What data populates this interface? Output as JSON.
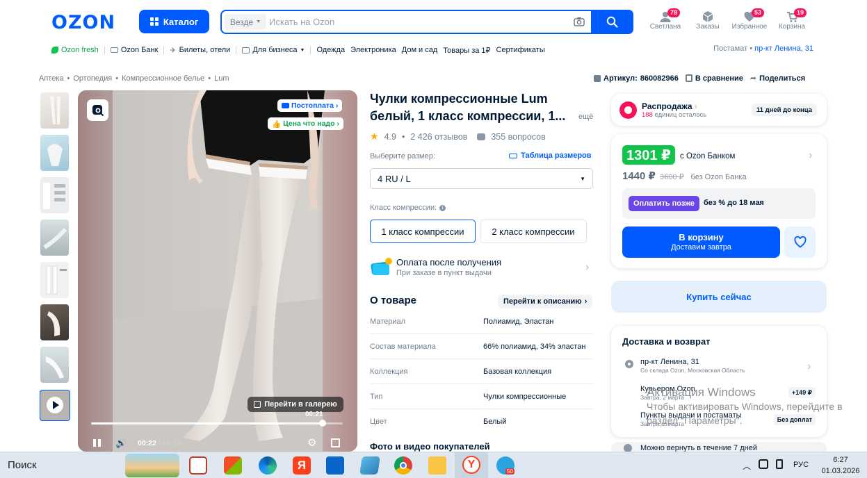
{
  "header": {
    "logo": "OZON",
    "catalog_label": "Каталог",
    "search_scope": "Везде",
    "search_placeholder": "Искать на Ozon",
    "icons": [
      {
        "label": "Светлана",
        "badge": "78",
        "icon": "user-icon"
      },
      {
        "label": "Заказы",
        "badge": "",
        "icon": "box-icon"
      },
      {
        "label": "Избранное",
        "badge": "53",
        "icon": "heart-icon"
      },
      {
        "label": "Корзина",
        "badge": "19",
        "icon": "cart-icon"
      }
    ]
  },
  "nav": {
    "items": [
      "Ozon fresh",
      "Ozon Банк",
      "Билеты, отели",
      "Для бизнеса",
      "Одежда",
      "Электроника",
      "Дом и сад",
      "Товары за 1₽",
      "Сертификаты"
    ],
    "address_label": "Постамат •",
    "address_value": "пр-кт Ленина, 31"
  },
  "breadcrumbs": [
    "Аптека",
    "Ортопедия",
    "Компрессионное белье",
    "Lum"
  ],
  "meta": {
    "article_label": "Артикул:",
    "article_value": "860082966",
    "compare": "В сравнение",
    "share": "Поделиться"
  },
  "media": {
    "postpay_badge": "Постоплата",
    "price_badge": "Цена что надо",
    "gallery_button": "Перейти в галерею",
    "time_hover": "00:21",
    "time_current": "00:22",
    "time_total": "00:24",
    "progress": 0.92
  },
  "product": {
    "title_line1": "Чулки компрессионные Lum",
    "title_line2": "белый, 1 класс компрессии, 1...",
    "more": "ещё",
    "rating": "4.9",
    "reviews": "2 426 отзывов",
    "questions": "355 вопросов",
    "size_label": "Выберите размер:",
    "size_table": "Таблица размеров",
    "size_value": "4 RU / L",
    "class_label": "Класс компрессии:",
    "class_options": [
      "1 класс компрессии",
      "2 класс компрессии"
    ],
    "payment_title": "Оплата после получения",
    "payment_sub": "При заказе в пункт выдачи",
    "about_title": "О товаре",
    "about_link": "Перейти к описанию",
    "specs": [
      {
        "k": "Материал",
        "v": "Полиамид, Эластан"
      },
      {
        "k": "Состав материала",
        "v": "66% полиамид, 34% эластан"
      },
      {
        "k": "Коллекция",
        "v": "Базовая коллекция"
      },
      {
        "k": "Тип",
        "v": "Чулки компрессионные"
      },
      {
        "k": "Цвет",
        "v": "Белый"
      }
    ],
    "photos_title": "Фото и видео покупателей"
  },
  "sale": {
    "title": "Распродажа",
    "sub_count": "188",
    "sub_text": "единиц осталось",
    "days": "11 дней до конца"
  },
  "price": {
    "bank_price": "1301 ₽",
    "bank_label": "с Ozon Банком",
    "regular": "1440 ₽",
    "old": "3600 ₽",
    "regular_label": "без Ozon Банка",
    "later_btn": "Оплатить позже",
    "later_text": "без % до 18 мая",
    "cart_btn": "В корзину",
    "cart_sub": "Доставим завтра",
    "buy_now": "Купить сейчас"
  },
  "delivery": {
    "title": "Доставка и возврат",
    "address": "пр-кт Ленина, 31",
    "address_sub": "Со склада Ozon, Московская Область",
    "courier": "Курьером Ozon",
    "courier_date": "Завтра, 2 марта",
    "courier_price": "+149 ₽",
    "pickup": "Пункты выдачи и постаматы",
    "pickup_date": "Завтра, 2 марта",
    "pickup_price": "Без доплат",
    "return": "Можно вернуть в течение 7 дней"
  },
  "watermark": {
    "line1": "Активация Windows",
    "line2": "Чтобы активировать Windows, перейдите в",
    "line3": "раздел \"Параметры\"."
  },
  "taskbar": {
    "search": "Поиск",
    "lang": "РУС",
    "time": "6:27",
    "date": "01.03.2026",
    "telegram_badge": "50"
  },
  "colors": {
    "brand": "#005bff",
    "accent_pink": "#f91155",
    "green": "#10c44c",
    "purple": "#6b46e6"
  }
}
